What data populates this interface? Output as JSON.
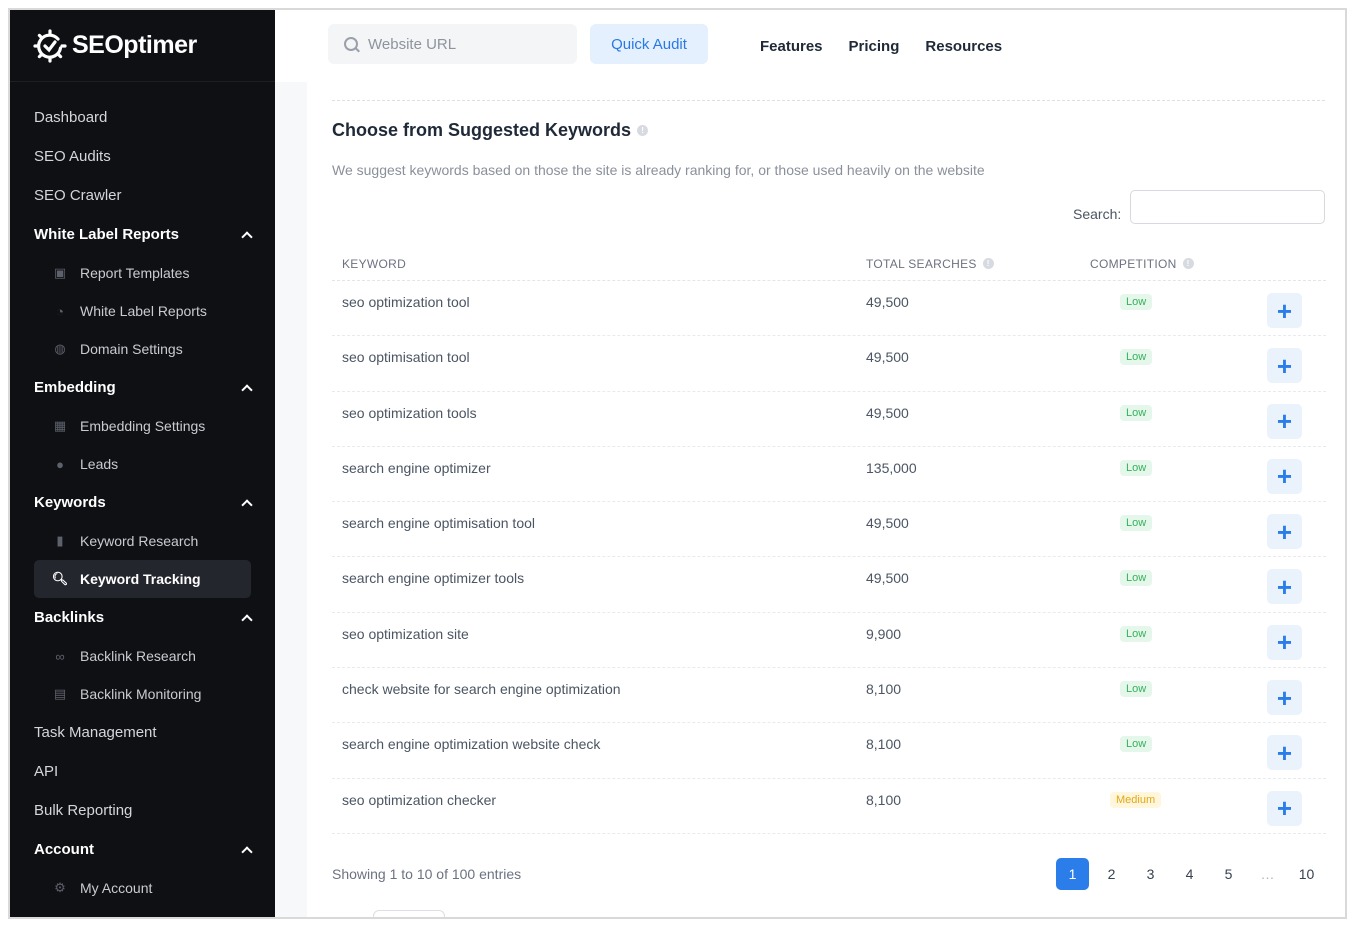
{
  "brand": {
    "name": "SEOptimer"
  },
  "header": {
    "url_placeholder": "Website URL",
    "quick_audit": "Quick Audit",
    "links": [
      "Features",
      "Pricing",
      "Resources"
    ]
  },
  "sidebar": {
    "items": [
      {
        "label": "Dashboard"
      },
      {
        "label": "SEO Audits"
      },
      {
        "label": "SEO Crawler"
      }
    ],
    "sections": [
      {
        "label": "White Label Reports",
        "children": [
          "Report Templates",
          "White Label Reports",
          "Domain Settings"
        ]
      },
      {
        "label": "Embedding",
        "children": [
          "Embedding Settings",
          "Leads"
        ]
      },
      {
        "label": "Keywords",
        "children": [
          "Keyword Research",
          "Keyword Tracking"
        ]
      },
      {
        "label": "Backlinks",
        "children": [
          "Backlink Research",
          "Backlink Monitoring"
        ]
      }
    ],
    "bottom_items": [
      {
        "label": "Task Management"
      },
      {
        "label": "API"
      },
      {
        "label": "Bulk Reporting"
      }
    ],
    "account": {
      "label": "Account",
      "children": [
        "My Account"
      ]
    },
    "active": "Keyword Tracking"
  },
  "main": {
    "title": "Choose from Suggested Keywords",
    "subtitle": "We suggest keywords based on those the site is already ranking for, or those used heavily on the website",
    "search_label": "Search:",
    "columns": {
      "keyword": "KEYWORD",
      "searches": "TOTAL SEARCHES",
      "competition": "COMPETITION"
    },
    "rows": [
      {
        "keyword": "seo optimization tool",
        "searches": "49,500",
        "competition": "Low"
      },
      {
        "keyword": "seo optimisation tool",
        "searches": "49,500",
        "competition": "Low"
      },
      {
        "keyword": "seo optimization tools",
        "searches": "49,500",
        "competition": "Low"
      },
      {
        "keyword": "search engine optimizer",
        "searches": "135,000",
        "competition": "Low"
      },
      {
        "keyword": "search engine optimisation tool",
        "searches": "49,500",
        "competition": "Low"
      },
      {
        "keyword": "search engine optimizer tools",
        "searches": "49,500",
        "competition": "Low"
      },
      {
        "keyword": "seo optimization site",
        "searches": "9,900",
        "competition": "Low"
      },
      {
        "keyword": "check website for search engine optimization",
        "searches": "8,100",
        "competition": "Low"
      },
      {
        "keyword": "search engine optimization website check",
        "searches": "8,100",
        "competition": "Low"
      },
      {
        "keyword": "seo optimization checker",
        "searches": "8,100",
        "competition": "Medium"
      }
    ],
    "showing": "Showing 1 to 10 of 100 entries",
    "pages": [
      "1",
      "2",
      "3",
      "4",
      "5",
      "…",
      "10"
    ],
    "active_page": "1"
  },
  "colors": {
    "accent": "#2b7de9",
    "sidebar_bg": "#0f1014",
    "low_badge": "#36b15b",
    "medium_badge": "#e3a812"
  }
}
